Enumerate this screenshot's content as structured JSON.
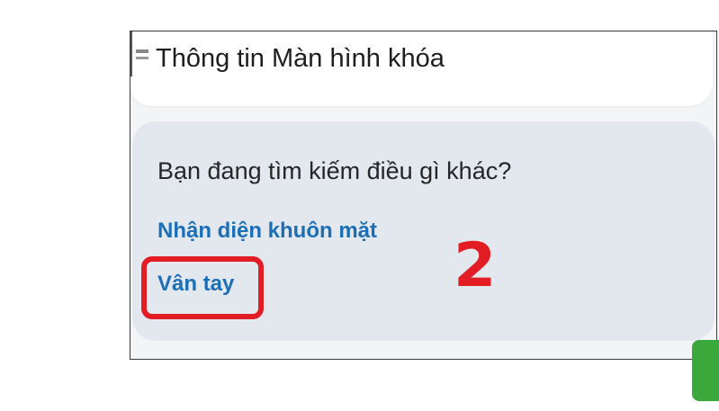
{
  "settings_item": {
    "label": "Thông tin Màn hình khóa"
  },
  "suggestions": {
    "title": "Bạn đang tìm kiếm điều gì khác?",
    "links": [
      {
        "label": "Nhận diện khuôn mặt"
      },
      {
        "label": "Vân tay"
      }
    ]
  },
  "annotation": {
    "step_number": "2",
    "highlight_color": "#e31d24"
  },
  "colors": {
    "link": "#1d6fb5",
    "card_background": "#e3e8ef",
    "accent_green": "#3aa83a"
  }
}
